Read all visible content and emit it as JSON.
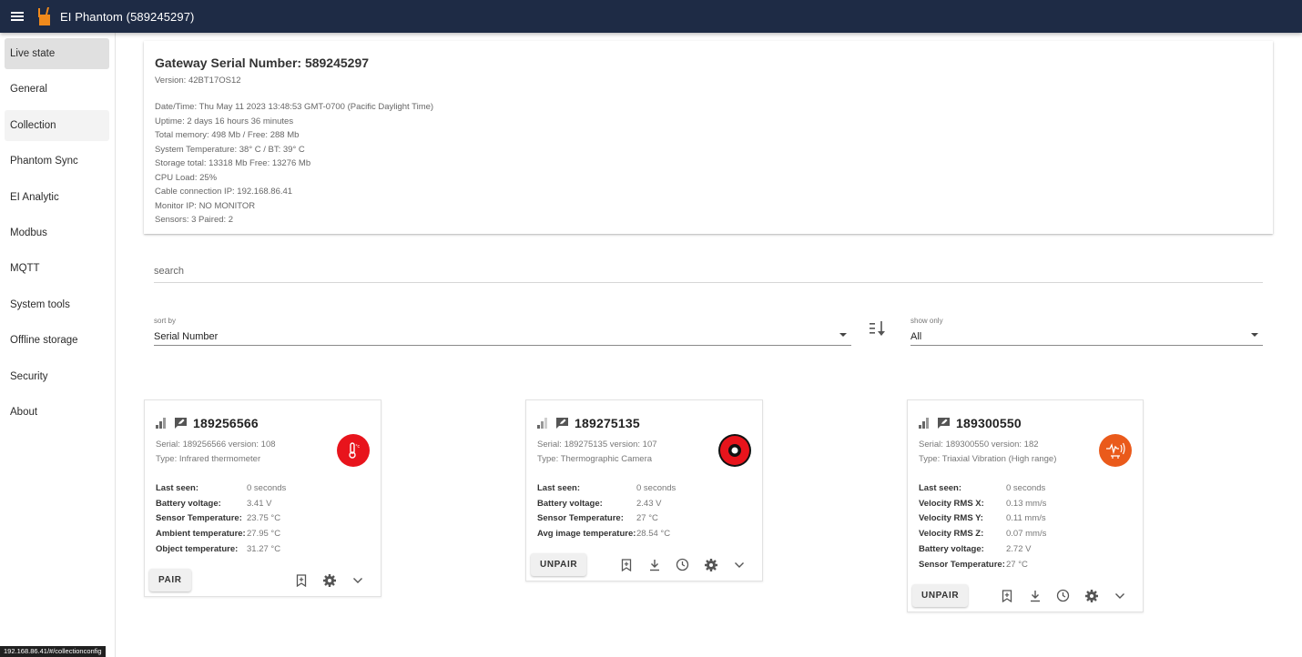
{
  "app": {
    "title": "EI Phantom (589245297)"
  },
  "sidebar": {
    "items": [
      {
        "label": "Live state"
      },
      {
        "label": "General"
      },
      {
        "label": "Collection"
      },
      {
        "label": "Phantom Sync"
      },
      {
        "label": "EI Analytic"
      },
      {
        "label": "Modbus"
      },
      {
        "label": "MQTT"
      },
      {
        "label": "System tools"
      },
      {
        "label": "Offline storage"
      },
      {
        "label": "Security"
      },
      {
        "label": "About"
      }
    ]
  },
  "gateway": {
    "title": "Gateway Serial Number: 589245297",
    "version": "Version: 42BT17OS12",
    "lines": [
      "Date/Time: Thu May 11 2023 13:48:53 GMT-0700 (Pacific Daylight Time)",
      "Uptime: 2 days 16 hours 36 minutes",
      "Total memory: 498 Mb / Free: 288 Mb",
      "System Temperature: 38° C / BT: 39° C",
      "Storage total: 13318 Mb Free: 13276 Mb",
      "CPU Load: 25%",
      "Cable connection IP: 192.168.86.41",
      "Monitor IP: NO MONITOR",
      "Sensors: 3 Paired: 2"
    ]
  },
  "search": {
    "placeholder": "search"
  },
  "sort": {
    "label": "sort by",
    "value": "Serial Number"
  },
  "filter": {
    "label": "show only",
    "value": "All"
  },
  "sensors": [
    {
      "serial": "189256566",
      "sub_serial": "Serial: 189256566 version: 108",
      "type": "Type: Infrared thermometer",
      "icon": "thermometer-icon",
      "icon_color": "#e8141c",
      "stats": [
        {
          "k": "Last seen:",
          "v": "0 seconds"
        },
        {
          "k": "Battery voltage:",
          "v": "3.41 V"
        },
        {
          "k": "Sensor Temperature:",
          "v": "23.75 °C"
        },
        {
          "k": "Ambient temperature:",
          "v": "27.95 °C"
        },
        {
          "k": "Object temperature:",
          "v": "31.27 °C"
        }
      ],
      "action": "PAIR"
    },
    {
      "serial": "189275135",
      "sub_serial": "Serial: 189275135 version: 107",
      "type": "Type: Thermographic Camera",
      "icon": "thermal-camera-icon",
      "icon_color": "#e8141c",
      "stats": [
        {
          "k": "Last seen:",
          "v": "0 seconds"
        },
        {
          "k": "Battery voltage:",
          "v": "2.43 V"
        },
        {
          "k": "Sensor Temperature:",
          "v": "27 °C"
        },
        {
          "k": "Avg image temperature:",
          "v": "28.54 °C"
        }
      ],
      "action": "UNPAIR"
    },
    {
      "serial": "189300550",
      "sub_serial": "Serial: 189300550 version: 182",
      "type": "Type: Triaxial Vibration (High range)",
      "icon": "vibration-icon",
      "icon_color": "#ea5a1b",
      "stats": [
        {
          "k": "Last seen:",
          "v": "0 seconds"
        },
        {
          "k": "Velocity RMS X:",
          "v": "0.13 mm/s"
        },
        {
          "k": "Velocity RMS Y:",
          "v": "0.11 mm/s"
        },
        {
          "k": "Velocity RMS Z:",
          "v": "0.07 mm/s"
        },
        {
          "k": "Battery voltage:",
          "v": "2.72 V"
        },
        {
          "k": "Sensor Temperature:",
          "v": "27 °C"
        }
      ],
      "action": "UNPAIR"
    }
  ],
  "statusbar": {
    "url": "192.168.86.41/#/collectionconfig"
  }
}
